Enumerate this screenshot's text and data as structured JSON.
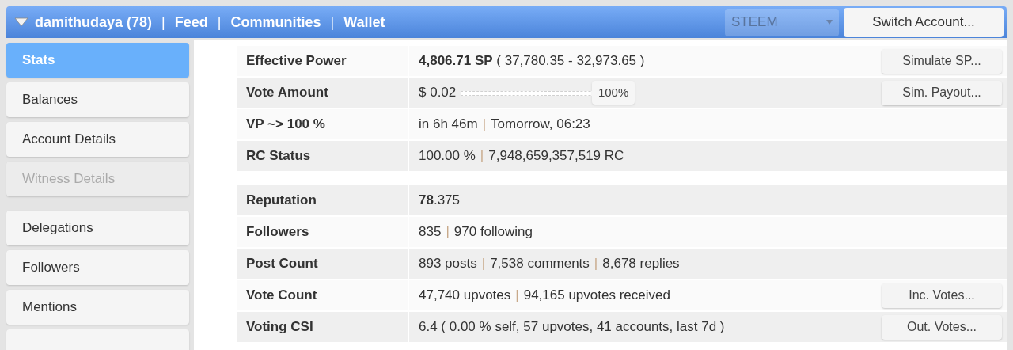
{
  "header": {
    "nav": [
      {
        "kind": "link",
        "text": "damithudaya (78)"
      },
      {
        "kind": "separator",
        "text": "|"
      },
      {
        "kind": "link",
        "text": "Feed"
      },
      {
        "kind": "separator",
        "text": "|"
      },
      {
        "kind": "link",
        "text": "Communities"
      },
      {
        "kind": "separator",
        "text": "|"
      },
      {
        "kind": "link",
        "text": "Wallet"
      }
    ],
    "chain_select": {
      "value": "STEEM"
    },
    "switch_button": "Switch Account..."
  },
  "sidebar": {
    "groups": [
      [
        {
          "label": "Stats",
          "selected": true,
          "disabled": false
        },
        {
          "label": "Balances",
          "selected": false,
          "disabled": false
        },
        {
          "label": "Account Details",
          "selected": false,
          "disabled": false
        },
        {
          "label": "Witness Details",
          "selected": false,
          "disabled": true
        }
      ],
      [
        {
          "label": "Delegations",
          "selected": false,
          "disabled": false
        },
        {
          "label": "Followers",
          "selected": false,
          "disabled": false
        },
        {
          "label": "Mentions",
          "selected": false,
          "disabled": false
        }
      ]
    ]
  },
  "stats": {
    "groups": [
      [
        {
          "label": "Effective Power",
          "value": [
            {
              "kind": "text",
              "text": "**4,806.71 SP** ( 37,780.35 - 32,973.65 )"
            }
          ],
          "button": "Simulate SP..."
        },
        {
          "label": "Vote Amount",
          "value": [
            {
              "kind": "text",
              "text": "$ 0.02"
            },
            {
              "kind": "slider",
              "level": 1,
              "text": "100%"
            }
          ],
          "button": "Sim. Payout..."
        },
        {
          "label": "VP ~> 100 %",
          "value": [
            {
              "kind": "text",
              "text": "in 6h 46m"
            },
            {
              "kind": "separator",
              "text": "|"
            },
            {
              "kind": "text",
              "text": "Tomorrow, 06:23"
            }
          ]
        },
        {
          "label": "RC Status",
          "value": [
            {
              "kind": "text",
              "text": "100.00 %"
            },
            {
              "kind": "separator",
              "text": "|"
            },
            {
              "kind": "text",
              "text": "7,948,659,357,519 RC"
            }
          ]
        }
      ],
      [
        {
          "label": "Reputation",
          "value": [
            {
              "kind": "text",
              "text": "**78**.375"
            }
          ]
        },
        {
          "label": "Followers",
          "value": [
            {
              "kind": "text",
              "text": "835"
            },
            {
              "kind": "separator",
              "text": "|"
            },
            {
              "kind": "text",
              "text": "970 following"
            }
          ]
        },
        {
          "label": "Post Count",
          "value": [
            {
              "kind": "text",
              "text": "893 posts"
            },
            {
              "kind": "separator",
              "text": "|"
            },
            {
              "kind": "text",
              "text": "7,538 comments"
            },
            {
              "kind": "separator",
              "text": "|"
            },
            {
              "kind": "text",
              "text": "8,678 replies"
            }
          ]
        },
        {
          "label": "Vote Count",
          "value": [
            {
              "kind": "text",
              "text": "47,740 upvotes"
            },
            {
              "kind": "separator",
              "text": "|"
            },
            {
              "kind": "text",
              "text": "94,165 upvotes received"
            }
          ],
          "button": "Inc. Votes..."
        },
        {
          "label": "Voting CSI",
          "value": [
            {
              "kind": "text",
              "text": "6.4 ( 0.00 % self, 57 upvotes, 41 accounts, last 7d )"
            }
          ],
          "button": "Out. Votes..."
        }
      ]
    ]
  }
}
